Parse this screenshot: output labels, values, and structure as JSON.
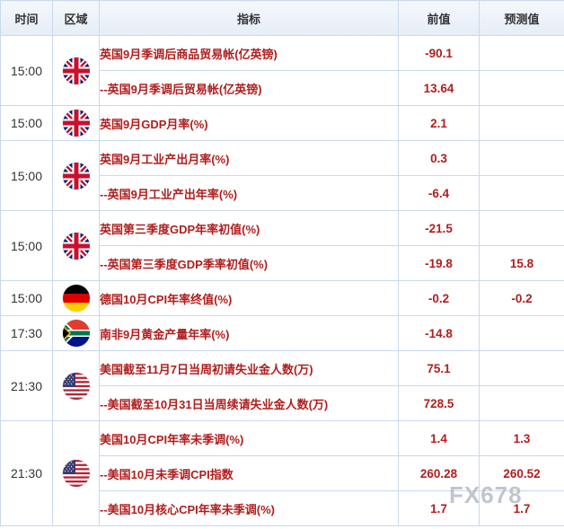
{
  "columns": {
    "time": "时间",
    "region": "区域",
    "indicator": "指标",
    "previous": "前值",
    "forecast": "预测值"
  },
  "groups": [
    {
      "time": "15:00",
      "flag": "uk-flag-icon",
      "rows": [
        {
          "indicator": "英国9月季调后商品贸易帐(亿英镑)",
          "previous": "-90.1",
          "forecast": ""
        },
        {
          "indicator": "--英国9月季调后贸易帐(亿英镑)",
          "previous": "13.64",
          "forecast": ""
        }
      ]
    },
    {
      "time": "15:00",
      "flag": "uk-flag-icon",
      "rows": [
        {
          "indicator": "英国9月GDP月率(%)",
          "previous": "2.1",
          "forecast": ""
        }
      ]
    },
    {
      "time": "15:00",
      "flag": "uk-flag-icon",
      "rows": [
        {
          "indicator": "英国9月工业产出月率(%)",
          "previous": "0.3",
          "forecast": ""
        },
        {
          "indicator": "--英国9月工业产出年率(%)",
          "previous": "-6.4",
          "forecast": ""
        }
      ]
    },
    {
      "time": "15:00",
      "flag": "uk-flag-icon",
      "rows": [
        {
          "indicator": "英国第三季度GDP年率初值(%)",
          "previous": "-21.5",
          "forecast": ""
        },
        {
          "indicator": "--英国第三季度GDP季率初值(%)",
          "previous": "-19.8",
          "forecast": "15.8"
        }
      ]
    },
    {
      "time": "15:00",
      "flag": "germany-flag-icon",
      "rows": [
        {
          "indicator": "德国10月CPI年率终值(%)",
          "previous": "-0.2",
          "forecast": "-0.2"
        }
      ]
    },
    {
      "time": "17:30",
      "flag": "south-africa-flag-icon",
      "rows": [
        {
          "indicator": "南非9月黄金产量年率(%)",
          "previous": "-14.8",
          "forecast": ""
        }
      ]
    },
    {
      "time": "21:30",
      "flag": "us-flag-icon",
      "rows": [
        {
          "indicator": "美国截至11月7日当周初请失业金人数(万)",
          "previous": "75.1",
          "forecast": ""
        },
        {
          "indicator": "--美国截至10月31日当周续请失业金人数(万)",
          "previous": "728.5",
          "forecast": ""
        }
      ]
    },
    {
      "time": "21:30",
      "flag": "us-flag-icon",
      "rows": [
        {
          "indicator": "美国10月CPI年率未季调(%)",
          "previous": "1.4",
          "forecast": "1.3"
        },
        {
          "indicator": "--美国10月未季调CPI指数",
          "previous": "260.28",
          "forecast": "260.52"
        },
        {
          "indicator": "--美国10月核心CPI年率未季调(%)",
          "previous": "1.7",
          "forecast": "1.7"
        }
      ]
    }
  ],
  "watermark": "FX678"
}
